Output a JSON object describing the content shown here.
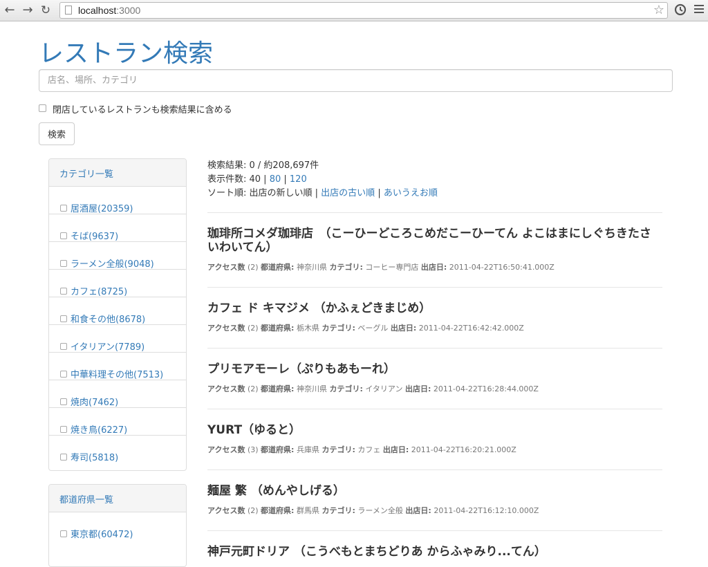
{
  "browser": {
    "url_host": "localhost",
    "url_port": ":3000"
  },
  "page": {
    "title": "レストラン検索",
    "search_placeholder": "店名、場所、カテゴリ",
    "include_closed_label": "閉店しているレストランも検索結果に含める",
    "search_button": "検索"
  },
  "categories": {
    "heading": "カテゴリ一覧",
    "items": [
      {
        "label": "居酒屋(20359)"
      },
      {
        "label": "そば(9637)"
      },
      {
        "label": "ラーメン全般(9048)"
      },
      {
        "label": "カフェ(8725)"
      },
      {
        "label": "和食その他(8678)"
      },
      {
        "label": "イタリアン(7789)"
      },
      {
        "label": "中華料理その他(7513)"
      },
      {
        "label": "焼肉(7462)"
      },
      {
        "label": "焼き鳥(6227)"
      },
      {
        "label": "寿司(5818)"
      }
    ]
  },
  "prefectures": {
    "heading": "都道府県一覧",
    "items": [
      {
        "label": "東京都(60472)"
      }
    ]
  },
  "results_meta": {
    "count_text": "検索結果: 0 / 約208,697件",
    "per_page_prefix": "表示件数: 40 | ",
    "per_page_80": "80",
    "sep": " | ",
    "per_page_120": "120",
    "sort_prefix": "ソート順: 出店の新しい順 | ",
    "sort_oldest": "出店の古い順",
    "sort_kana": "あいうえお順"
  },
  "detail_labels": {
    "access": "アクセス数",
    "pref": "都道府県:",
    "category": "カテゴリ:",
    "opened": "出店日:"
  },
  "results": [
    {
      "name": "珈琲所コメダ珈琲店　（こーひーどころこめだこーひーてん よこはまにしぐちきたさいわいてん）",
      "access": "(2)",
      "pref": "神奈川県",
      "category": "コーヒー専門店",
      "opened": "2011-04-22T16:50:41.000Z"
    },
    {
      "name": "カフェ ド キマジメ （かふぇどきまじめ）",
      "access": "(2)",
      "pref": "栃木県",
      "category": "ベーグル",
      "opened": "2011-04-22T16:42:42.000Z"
    },
    {
      "name": "プリモアモーレ（ぷりもあもーれ）",
      "access": "(2)",
      "pref": "神奈川県",
      "category": "イタリアン",
      "opened": "2011-04-22T16:28:44.000Z"
    },
    {
      "name": "YURT（ゆると）",
      "access": "(3)",
      "pref": "兵庫県",
      "category": "カフェ",
      "opened": "2011-04-22T16:20:21.000Z"
    },
    {
      "name": "麺屋 繁 （めんやしげる）",
      "access": "(2)",
      "pref": "群馬県",
      "category": "ラーメン全般",
      "opened": "2011-04-22T16:12:10.000Z"
    },
    {
      "name": "神戸元町ドリア （こうべもとまちどりあ からふゃみり...てん）"
    }
  ]
}
